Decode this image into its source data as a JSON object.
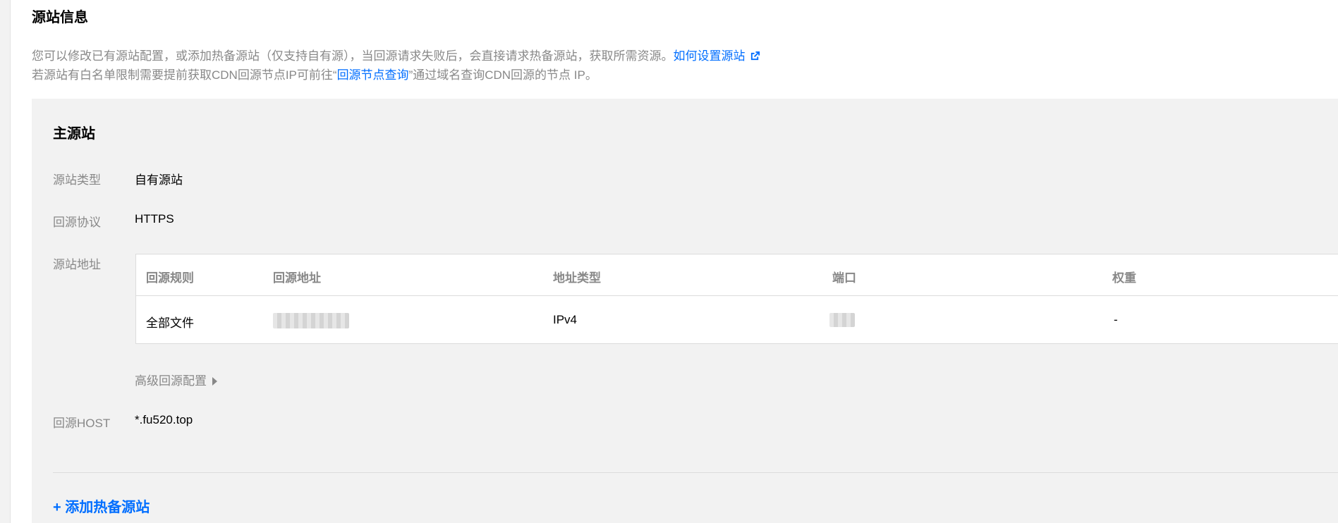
{
  "section": {
    "title": "源站信息",
    "desc_line1": "您可以修改已有源站配置，或添加热备源站（仅支持自有源），当回源请求失败后，会直接请求热备源站，获取所需资源。",
    "desc_link1": "如何设置源站",
    "desc_line2_prefix": "若源站有白名单限制需要提前获取CDN回源节点IP可前往“",
    "desc_link2": "回源节点查询",
    "desc_line2_suffix": "”通过域名查询CDN回源的节点 IP。"
  },
  "primary": {
    "title": "主源站",
    "origin_type_label": "源站类型",
    "origin_type_value": "自有源站",
    "protocol_label": "回源协议",
    "protocol_value": "HTTPS",
    "address_label": "源站地址",
    "table": {
      "headers": [
        "回源规则",
        "回源地址",
        "地址类型",
        "端口",
        "权重"
      ],
      "rows": [
        {
          "rule": "全部文件",
          "address": "",
          "addr_type": "IPv4",
          "port": "",
          "weight": "-"
        }
      ]
    },
    "advanced_label": "高级回源配置",
    "host_label": "回源HOST",
    "host_value": "*.fu520.top"
  },
  "add_backup_label": "+ 添加热备源站",
  "colors": {
    "link": "#006eff",
    "muted": "#888888",
    "panel_bg": "#f2f2f2"
  },
  "icons": {
    "external_link": "external-link-icon",
    "caret": "caret-right-icon"
  }
}
